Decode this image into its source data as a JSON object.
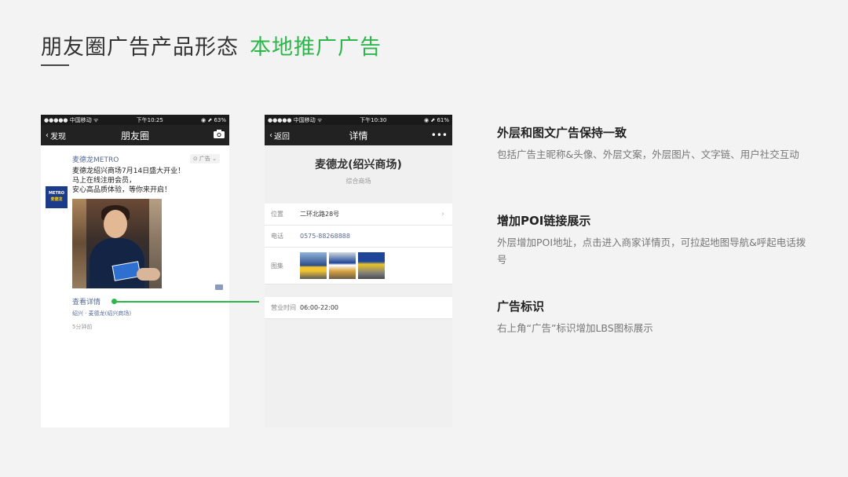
{
  "slide": {
    "title": "朋友圈广告产品形态",
    "title_accent": "本地推广广告",
    "accent_color": "#2db74a"
  },
  "phone1": {
    "status": {
      "carrier": "●●●●● 中国移动 ᯤ",
      "time": "下午10:25",
      "battery": "◉ ⬈ 63%"
    },
    "nav": {
      "back": "发现",
      "title": "朋友圈",
      "right_icon": "camera-icon"
    },
    "post": {
      "logo_text": "METRO",
      "logo_text2": "麦德龙",
      "author": "麦德龙METRO",
      "ad_badge": "⊙ 广告 ⌄",
      "lines": [
        "麦德龙绍兴商场7月14日盛大开业！",
        "马上在线注册会员，",
        "安心高品质体验，等你来开启！"
      ],
      "view_details": "查看详情",
      "poi": "绍兴 · 麦德龙(绍兴商场)",
      "time_ago": "5分钟前"
    }
  },
  "phone2": {
    "status": {
      "carrier": "●●●●● 中国移动 ᯤ",
      "time": "下午10:30",
      "battery": "◉ ⬈ 61%"
    },
    "nav": {
      "back": "返回",
      "title": "详情",
      "right": "•••"
    },
    "store_name": "麦德龙(绍兴商场)",
    "category": "综合商场",
    "rows": [
      {
        "label": "位置",
        "value": "二环北路28号"
      },
      {
        "label": "电话",
        "value": "0575-88268888"
      },
      {
        "label": "图集",
        "value": ""
      }
    ],
    "hours": {
      "label": "营业时间",
      "value": "06:00-22:00"
    }
  },
  "features": [
    {
      "title": "外层和图文广告保持一致",
      "desc": "包括广告主昵称&头像、外层文案，外层图片、文字链、用户社交互动"
    },
    {
      "title": "增加POI链接展示",
      "desc": "外层增加POI地址，点击进入商家详情页，可拉起地图导航&呼起电话拨号"
    },
    {
      "title": "广告标识",
      "desc": "右上角“广告”标识增加LBS图标展示"
    }
  ]
}
